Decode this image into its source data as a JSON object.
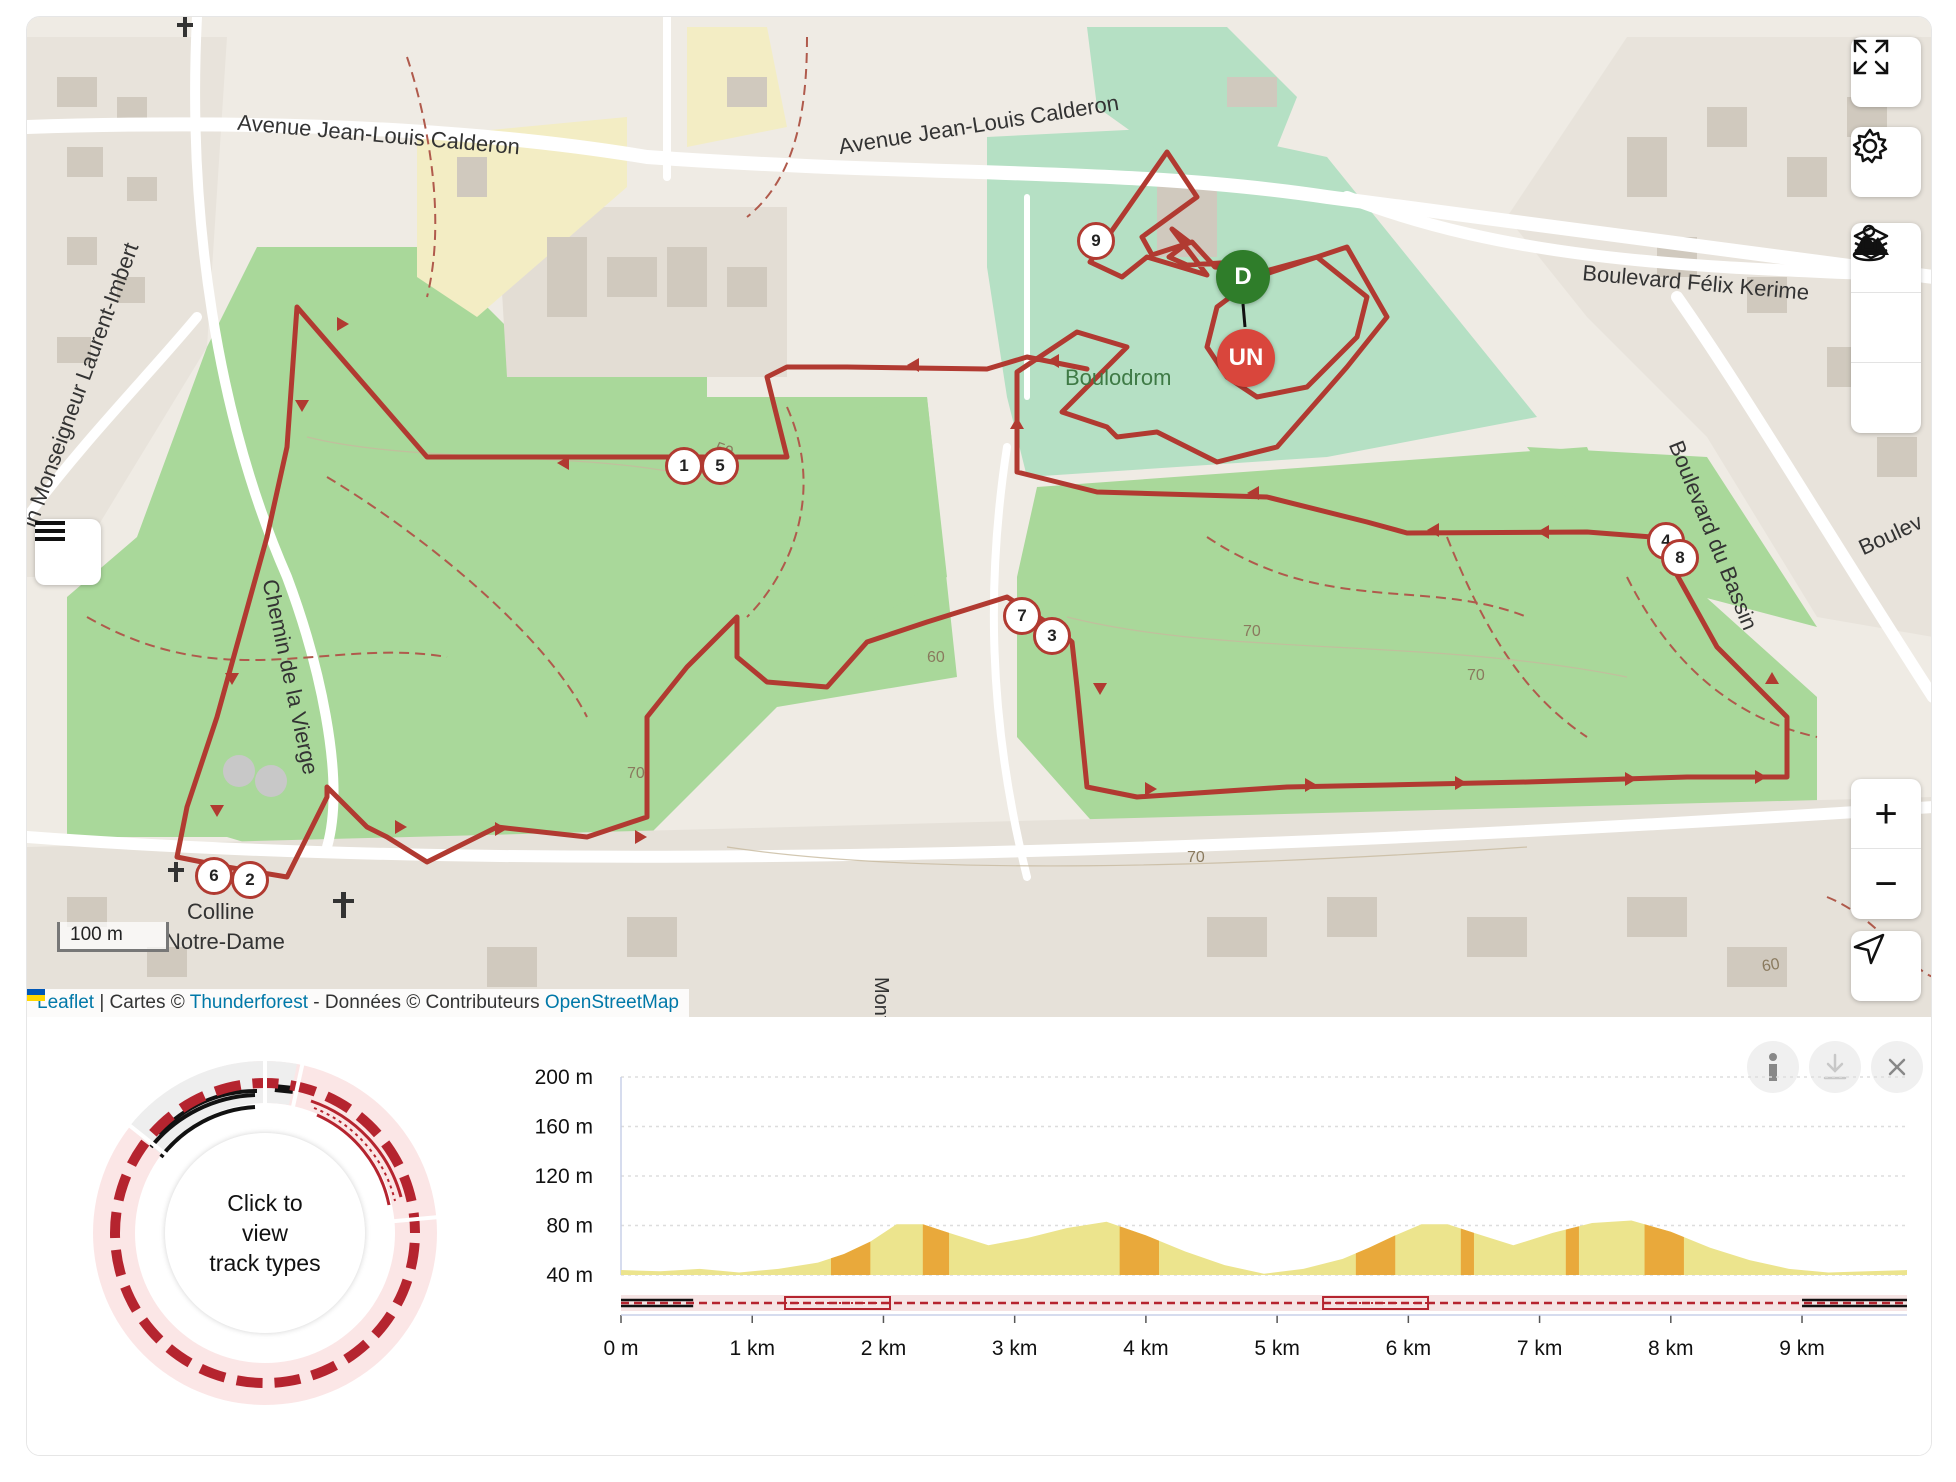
{
  "map": {
    "street_labels": {
      "avenue_left": "Avenue Jean-Louis Calderon",
      "avenue_right": "Avenue Jean-Louis Calderon",
      "boulevard_felix": "Boulevard Félix Kerime",
      "boulevard_bassin": "Boulevard du Bassin",
      "boulevard_edge": "Boulev",
      "chemin_monseigneur": "in Monseigneur Laurent-Imbert",
      "chemin_vierge": "Chemin de la Vierge",
      "boulodrome": "Boulodrom",
      "colline_1": "Colline",
      "colline_2": "Notre-Dame",
      "mont": "Mont"
    },
    "contour_labels": [
      "50",
      "60",
      "70",
      "70",
      "70",
      "70",
      "60"
    ],
    "waypoints": [
      "1",
      "5",
      "9",
      "4",
      "8",
      "7",
      "3",
      "6",
      "2"
    ],
    "start_label": "D",
    "end_label": "UN",
    "scale_label": "100 m",
    "attribution": {
      "leaflet": "Leaflet",
      "sep": " | Cartes © ",
      "thunderforest": "Thunderforest",
      "donnees": " - Données © Contributeurs ",
      "osm": "OpenStreetMap"
    },
    "controls": {
      "fullscreen": "fullscreen-icon",
      "settings": "gear-icon",
      "layers": "layers-icon",
      "terrain": "mountain-icon",
      "person": "pegman-icon",
      "zoom_in": "+",
      "zoom_out": "−",
      "locate": "locate-arrow-icon",
      "menu": "menu-icon"
    },
    "colors": {
      "route": "#b13a31",
      "forest": "#a9d89a",
      "park": "#b5e0c4",
      "start": "#2f7d2a",
      "end": "#d9463c"
    }
  },
  "track_types": {
    "center_text_1": "Click to",
    "center_text_2": "view",
    "center_text_3": "track types"
  },
  "elevation_buttons": {
    "info": "info-icon",
    "download": "download-icon",
    "close": "close-icon"
  },
  "chart_data": {
    "type": "area",
    "title": "",
    "xlabel": "",
    "ylabel": "",
    "x_unit": "km",
    "y_unit": "m",
    "xlim": [
      0,
      9.8
    ],
    "ylim": [
      40,
      200
    ],
    "x_ticks": [
      "0 m",
      "1 km",
      "2 km",
      "3 km",
      "4 km",
      "5 km",
      "6 km",
      "7 km",
      "8 km",
      "9 km"
    ],
    "y_ticks": [
      "40 m",
      "80 m",
      "120 m",
      "160 m",
      "200 m"
    ],
    "x": [
      0,
      0.3,
      0.6,
      0.9,
      1.2,
      1.5,
      1.7,
      1.9,
      2.1,
      2.3,
      2.5,
      2.8,
      3.1,
      3.4,
      3.7,
      4.0,
      4.3,
      4.6,
      4.9,
      5.2,
      5.5,
      5.7,
      5.9,
      6.1,
      6.3,
      6.5,
      6.8,
      7.1,
      7.4,
      7.7,
      8.0,
      8.3,
      8.6,
      8.9,
      9.2,
      9.5,
      9.8
    ],
    "y": [
      44,
      43,
      45,
      42,
      45,
      50,
      57,
      67,
      81,
      81,
      74,
      64,
      70,
      78,
      83,
      72,
      59,
      48,
      41,
      45,
      53,
      62,
      72,
      81,
      81,
      74,
      64,
      74,
      82,
      84,
      75,
      62,
      52,
      45,
      42,
      43,
      44
    ],
    "steep_segments_km": [
      [
        1.6,
        1.9
      ],
      [
        2.3,
        2.5
      ],
      [
        3.8,
        4.1
      ],
      [
        5.6,
        5.9
      ],
      [
        6.4,
        6.5
      ],
      [
        7.2,
        7.3
      ],
      [
        7.8,
        8.1
      ]
    ],
    "grid": true
  }
}
